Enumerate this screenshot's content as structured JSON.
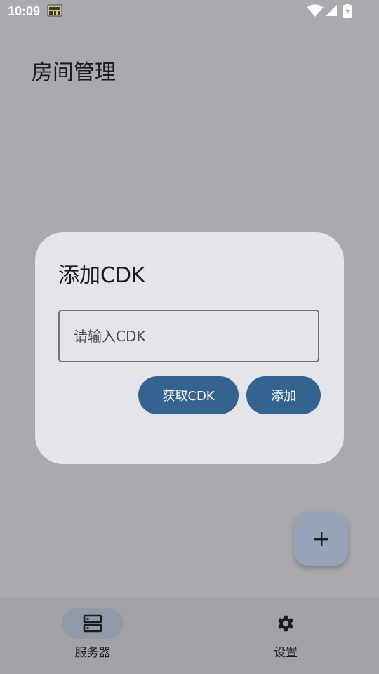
{
  "status_bar": {
    "time": "10:09",
    "icons": [
      "notification-app-icon",
      "wifi-icon",
      "signal-icon",
      "battery-charging-icon"
    ]
  },
  "page": {
    "title": "房间管理"
  },
  "dialog": {
    "title": "添加CDK",
    "input": {
      "placeholder": "请输入CDK",
      "value": ""
    },
    "get_cdk_label": "获取CDK",
    "add_label": "添加"
  },
  "fab": {
    "icon": "plus-icon"
  },
  "bottom_nav": {
    "items": [
      {
        "label": "服务器",
        "icon": "server-icon",
        "selected": true
      },
      {
        "label": "设置",
        "icon": "gear-icon",
        "selected": false
      }
    ]
  },
  "colors": {
    "scrim_background": "#a9aaaf",
    "dialog_surface": "#e4e5ea",
    "primary_button": "#356390",
    "fab": "#97a3b6",
    "nav_bar": "#a2a3a8",
    "nav_active_pill": "#909aa8"
  }
}
